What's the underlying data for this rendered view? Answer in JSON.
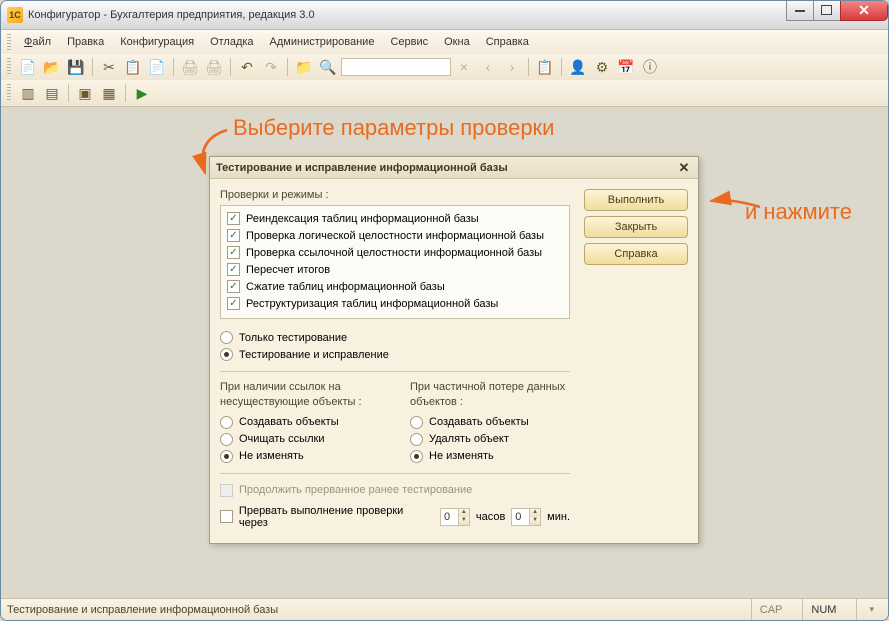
{
  "titlebar": {
    "title": "Конфигуратор - Бухгалтерия предприятия, редакция 3.0"
  },
  "menubar": {
    "file": "Файл",
    "edit": "Правка",
    "config": "Конфигурация",
    "debug": "Отладка",
    "admin": "Администрирование",
    "service": "Сервис",
    "windows": "Окна",
    "help": "Справка"
  },
  "dialog": {
    "title": "Тестирование и исправление информационной базы",
    "section_label": "Проверки и режимы :",
    "checks": [
      {
        "label": "Реиндексация таблиц информационной базы",
        "checked": true
      },
      {
        "label": "Проверка логической целостности информационной базы",
        "checked": true
      },
      {
        "label": "Проверка ссылочной целостности информационной базы",
        "checked": true
      },
      {
        "label": "Пересчет итогов",
        "checked": true
      },
      {
        "label": "Сжатие таблиц информационной базы",
        "checked": true
      },
      {
        "label": "Реструктуризация таблиц информационной базы",
        "checked": true
      }
    ],
    "mode_options": [
      {
        "label": "Только тестирование",
        "selected": false
      },
      {
        "label": "Тестирование и исправление",
        "selected": true
      }
    ],
    "refs_heading": "При наличии ссылок на несуществующие объекты :",
    "partial_heading": "При частичной потере данных объектов :",
    "refs_options": [
      {
        "label": "Создавать объекты",
        "selected": false
      },
      {
        "label": "Очищать ссылки",
        "selected": false
      },
      {
        "label": "Не изменять",
        "selected": true
      }
    ],
    "partial_options": [
      {
        "label": "Создавать объекты",
        "selected": false
      },
      {
        "label": "Удалять объект",
        "selected": false
      },
      {
        "label": "Не изменять",
        "selected": true
      }
    ],
    "continue_label": "Продолжить прерванное ранее тестирование",
    "interrupt_label": "Прервать выполнение проверки через",
    "hours_value": "0",
    "hours_label": "часов",
    "minutes_value": "0",
    "minutes_label": "мин.",
    "buttons": {
      "execute": "Выполнить",
      "close": "Закрыть",
      "help": "Справка"
    }
  },
  "statusbar": {
    "text": "Тестирование и исправление информационной базы",
    "cap": "CAP",
    "num": "NUM"
  },
  "annotations": {
    "top": "Выберите параметры проверки",
    "right": "и нажмите"
  }
}
